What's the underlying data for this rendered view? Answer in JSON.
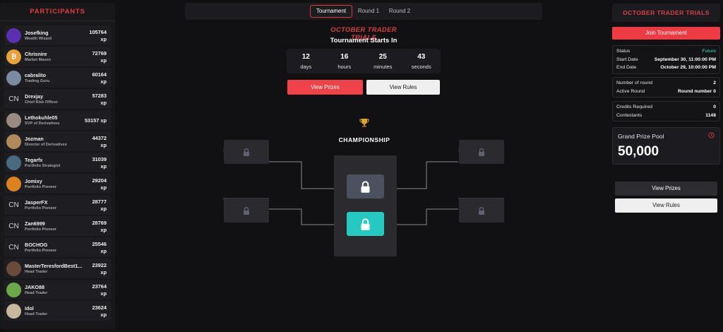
{
  "participants": {
    "title": "PARTICIPANTS",
    "items": [
      {
        "name": "Josefking",
        "title": "Wealth Wizard",
        "score": "105764",
        "unit": "xp",
        "avatar": "purple-logo",
        "color": "#5a2fb0"
      },
      {
        "name": "Chrisnire",
        "title": "Market Maven",
        "score": "72769",
        "unit": "xp",
        "avatar": "bitcoin",
        "color": "#e9a23b"
      },
      {
        "name": "cabralito",
        "title": "Trading Guru",
        "score": "60164",
        "unit": "xp",
        "avatar": "photo",
        "color": "#7a8aa0"
      },
      {
        "name": "Drexjay",
        "title": "Chief Risk Officer",
        "score": "57283",
        "unit": "xp",
        "avatar": "CN",
        "color": ""
      },
      {
        "name": "Lethokuhle05",
        "title": "SVP of Derivatives",
        "score": "53157",
        "unit": "xp",
        "avatar": "photo",
        "color": "#9a8a80"
      },
      {
        "name": "Jozman",
        "title": "Director of Derivatives",
        "score": "44372",
        "unit": "xp",
        "avatar": "photo",
        "color": "#b08a5a"
      },
      {
        "name": "Tegarfx",
        "title": "Portfolio Strategist",
        "score": "31039",
        "unit": "xp",
        "avatar": "photo",
        "color": "#4a6a80"
      },
      {
        "name": "Jomixy",
        "title": "Portfolio Pioneer",
        "score": "29204",
        "unit": "xp",
        "avatar": "tiger",
        "color": "#d9821f"
      },
      {
        "name": "JasperFX",
        "title": "Portfolio Pioneer",
        "score": "28777",
        "unit": "xp",
        "avatar": "CN",
        "color": ""
      },
      {
        "name": "Zan6999",
        "title": "Portfolio Pioneer",
        "score": "28769",
        "unit": "xp",
        "avatar": "CN",
        "color": ""
      },
      {
        "name": "BOCHOG",
        "title": "Portfolio Pioneer",
        "score": "25546",
        "unit": "xp",
        "avatar": "CN",
        "color": ""
      },
      {
        "name": "MasterTeresfordBest1...",
        "title": "Head Trader",
        "score": "23922",
        "unit": "xp",
        "avatar": "photo",
        "color": "#6a4a3a"
      },
      {
        "name": "JAKO88",
        "title": "Head Trader",
        "score": "23764",
        "unit": "xp",
        "avatar": "photo",
        "color": "#6aa84a"
      },
      {
        "name": "Idol",
        "title": "Head Trader",
        "score": "23624",
        "unit": "xp",
        "avatar": "photo",
        "color": "#c8b8a0"
      }
    ]
  },
  "tabs": [
    {
      "label": "Tournament",
      "active": true
    },
    {
      "label": "Round 1",
      "active": false
    },
    {
      "label": "Round 2",
      "active": false
    }
  ],
  "center": {
    "brand": "OCTOBER TRADER TRIALS",
    "heading": "Tournament Starts In",
    "countdown": [
      {
        "value": "12",
        "label": "days"
      },
      {
        "value": "16",
        "label": "hours"
      },
      {
        "value": "25",
        "label": "minutes"
      },
      {
        "value": "43",
        "label": "seconds"
      }
    ],
    "view_prizes": "View Prizes",
    "view_rules": "View Rules",
    "championship": "CHAMPIONSHIP"
  },
  "right": {
    "title": "OCTOBER TRADER TRIALS",
    "join": "Join Tournament",
    "status_rows": [
      {
        "label": "Status",
        "value": "Future",
        "accent": true
      },
      {
        "label": "Start Date",
        "value": "September 30, 11:00:00 PM",
        "accent": false
      },
      {
        "label": "End Date",
        "value": "October 29, 10:00:00 PM",
        "accent": false
      }
    ],
    "round_rows": [
      {
        "label": "Number of round",
        "value": "2"
      },
      {
        "label": "Active Round",
        "value": "Round number 0"
      }
    ],
    "credit_rows": [
      {
        "label": "Credits Required",
        "value": "0"
      },
      {
        "label": "Contestants",
        "value": "1148"
      }
    ],
    "prize_pool_label": "Grand Prize Pool",
    "prize_pool_value": "50,000",
    "view_prizes": "View Prizes",
    "view_rules": "View Rules"
  },
  "colors": {
    "accent_red": "#ee4349",
    "accent_teal": "#26c9c2",
    "status_green": "#3fd5c0"
  }
}
